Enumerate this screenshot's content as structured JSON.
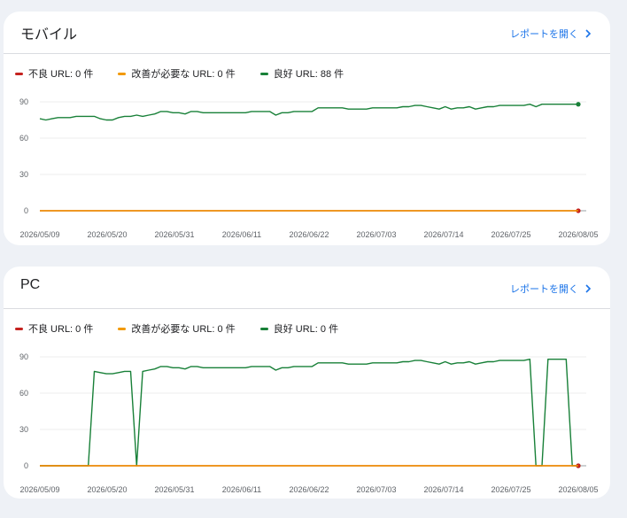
{
  "cards": [
    {
      "title": "モバイル",
      "report_link": "レポートを開く",
      "legend": [
        {
          "label": "不良 URL: 0 件",
          "color": "#c5221f"
        },
        {
          "label": "改善が必要な URL: 0 件",
          "color": "#f29900"
        },
        {
          "label": "良好 URL: 88 件",
          "color": "#188038"
        }
      ]
    },
    {
      "title": "PC",
      "report_link": "レポートを開く",
      "legend": [
        {
          "label": "不良 URL: 0 件",
          "color": "#c5221f"
        },
        {
          "label": "改善が必要な URL: 0 件",
          "color": "#f29900"
        },
        {
          "label": "良好 URL: 0 件",
          "color": "#188038"
        }
      ]
    }
  ],
  "chart_data": [
    {
      "type": "line",
      "y_ticks": [
        "90",
        "60",
        "30",
        "0"
      ],
      "ylim": [
        0,
        90
      ],
      "x_ticks": [
        "2026/05/09",
        "2026/05/20",
        "2026/05/31",
        "2026/06/11",
        "2026/06/22",
        "2026/07/03",
        "2026/07/14",
        "2026/07/25",
        "2026/08/05"
      ],
      "grid": true,
      "series": [
        {
          "color": "#188038",
          "values": [
            76,
            75,
            76,
            77,
            77,
            77,
            78,
            78,
            78,
            78,
            76,
            75,
            75,
            77,
            78,
            78,
            79,
            78,
            79,
            80,
            82,
            82,
            81,
            81,
            80,
            82,
            82,
            81,
            81,
            81,
            81,
            81,
            81,
            81,
            81,
            82,
            82,
            82,
            82,
            79,
            81,
            81,
            82,
            82,
            82,
            82,
            85,
            85,
            85,
            85,
            85,
            84,
            84,
            84,
            84,
            85,
            85,
            85,
            85,
            85,
            86,
            86,
            87,
            87,
            86,
            85,
            84,
            86,
            84,
            85,
            85,
            86,
            84,
            85,
            86,
            86,
            87,
            87,
            87,
            87,
            87,
            88,
            86,
            88,
            88,
            88,
            88,
            88,
            88,
            88
          ]
        },
        {
          "color": "#c5221f",
          "values": [
            0
          ]
        },
        {
          "color": "#f29900",
          "values": [
            0
          ]
        }
      ]
    },
    {
      "type": "line",
      "y_ticks": [
        "90",
        "60",
        "30",
        "0"
      ],
      "ylim": [
        0,
        90
      ],
      "x_ticks": [
        "2026/05/09",
        "2026/05/20",
        "2026/05/31",
        "2026/06/11",
        "2026/06/22",
        "2026/07/03",
        "2026/07/14",
        "2026/07/25",
        "2026/08/05"
      ],
      "grid": true,
      "series": [
        {
          "color": "#188038",
          "values": [
            0,
            0,
            0,
            0,
            0,
            0,
            0,
            0,
            0,
            78,
            77,
            76,
            76,
            77,
            78,
            78,
            0,
            78,
            79,
            80,
            82,
            82,
            81,
            81,
            80,
            82,
            82,
            81,
            81,
            81,
            81,
            81,
            81,
            81,
            81,
            82,
            82,
            82,
            82,
            79,
            81,
            81,
            82,
            82,
            82,
            82,
            85,
            85,
            85,
            85,
            85,
            84,
            84,
            84,
            84,
            85,
            85,
            85,
            85,
            85,
            86,
            86,
            87,
            87,
            86,
            85,
            84,
            86,
            84,
            85,
            85,
            86,
            84,
            85,
            86,
            86,
            87,
            87,
            87,
            87,
            87,
            88,
            0,
            0,
            88,
            88,
            88,
            88,
            0,
            0
          ]
        },
        {
          "color": "#c5221f",
          "values": [
            0
          ]
        },
        {
          "color": "#f29900",
          "values": [
            0
          ]
        }
      ]
    }
  ]
}
